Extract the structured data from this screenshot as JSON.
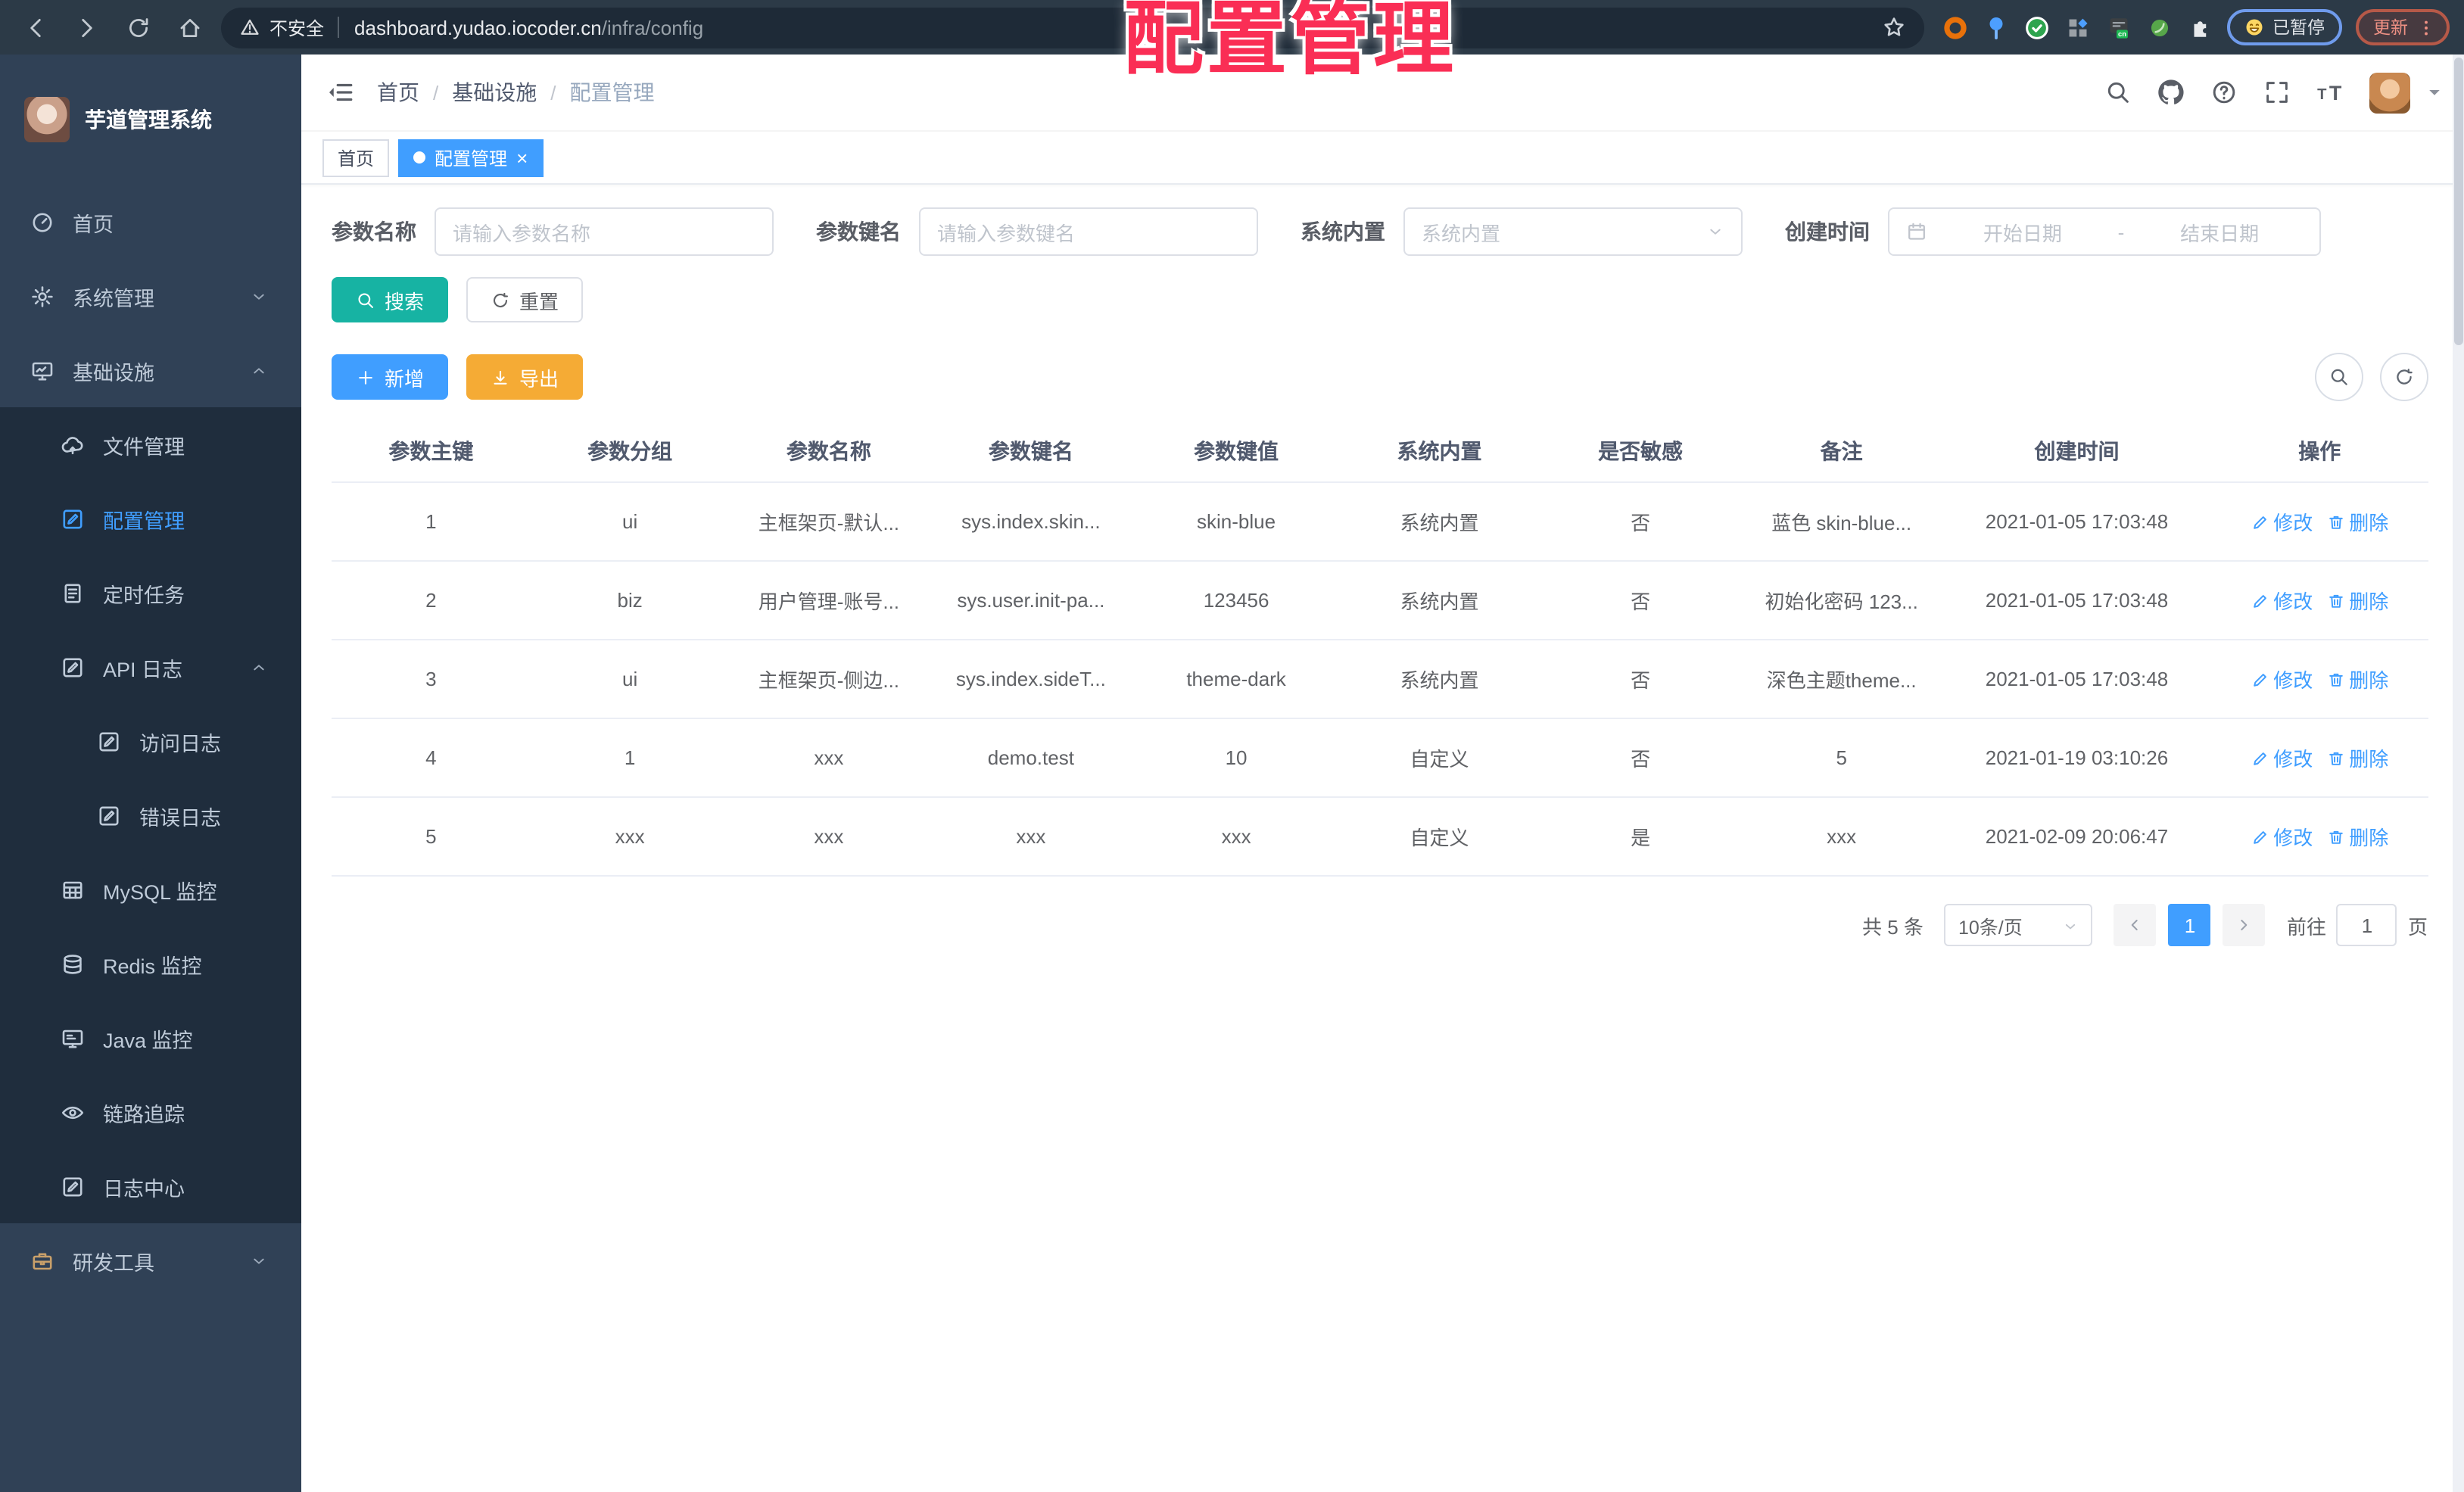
{
  "browser": {
    "security_label": "不安全",
    "url_host": "dashboard.yudao.iocoder.cn",
    "url_path": "/infra/config",
    "paused_label": "已暂停",
    "update_label": "更新"
  },
  "overlay_title": "配置管理",
  "colors": {
    "accent": "#409EFF",
    "success": "#17B3A3",
    "warning": "#F5AB35",
    "sidebar_bg": "#304156",
    "submenu_bg": "#1F2D3D",
    "annotation_red": "#FA2E55"
  },
  "sidebar": {
    "title": "芋道管理系统",
    "items": [
      {
        "icon": "dashboard",
        "label": "首页",
        "depth": 0
      },
      {
        "icon": "gear",
        "label": "系统管理",
        "depth": 0,
        "chevron": "down"
      },
      {
        "icon": "infra",
        "label": "基础设施",
        "depth": 0,
        "chevron": "up"
      },
      {
        "icon": "cloud",
        "label": "文件管理",
        "depth": 1,
        "sub": true
      },
      {
        "icon": "edit",
        "label": "配置管理",
        "depth": 1,
        "sub": true,
        "active": true
      },
      {
        "icon": "doc",
        "label": "定时任务",
        "depth": 1,
        "sub": true
      },
      {
        "icon": "edit",
        "label": "API 日志",
        "depth": 1,
        "sub": true,
        "chevron": "up"
      },
      {
        "icon": "edit",
        "label": "访问日志",
        "depth": 2,
        "sub": true
      },
      {
        "icon": "edit",
        "label": "错误日志",
        "depth": 2,
        "sub": true
      },
      {
        "icon": "mysql",
        "label": "MySQL 监控",
        "depth": 1,
        "sub": true
      },
      {
        "icon": "redis",
        "label": "Redis 监控",
        "depth": 1,
        "sub": true
      },
      {
        "icon": "java",
        "label": "Java 监控",
        "depth": 1,
        "sub": true
      },
      {
        "icon": "eye",
        "label": "链路追踪",
        "depth": 1,
        "sub": true
      },
      {
        "icon": "edit",
        "label": "日志中心",
        "depth": 1,
        "sub": true
      },
      {
        "icon": "toolbox",
        "label": "研发工具",
        "depth": 0,
        "chevron": "down"
      }
    ]
  },
  "header": {
    "breadcrumb": [
      "首页",
      "基础设施",
      "配置管理"
    ]
  },
  "tags": {
    "home": "首页",
    "current": "配置管理"
  },
  "filters": {
    "name_label": "参数名称",
    "name_placeholder": "请输入参数名称",
    "key_label": "参数键名",
    "key_placeholder": "请输入参数键名",
    "type_label": "系统内置",
    "type_placeholder": "系统内置",
    "date_label": "创建时间",
    "date_start_placeholder": "开始日期",
    "date_separator": "-",
    "date_end_placeholder": "结束日期"
  },
  "actions": {
    "search": "搜索",
    "reset": "重置",
    "add": "新增",
    "export": "导出"
  },
  "table": {
    "columns": [
      "参数主键",
      "参数分组",
      "参数名称",
      "参数键名",
      "参数键值",
      "系统内置",
      "是否敏感",
      "备注",
      "创建时间",
      "操作"
    ],
    "rows": [
      [
        "1",
        "ui",
        "主框架页-默认...",
        "sys.index.skin...",
        "skin-blue",
        "系统内置",
        "否",
        "蓝色 skin-blue...",
        "2021-01-05 17:03:48"
      ],
      [
        "2",
        "biz",
        "用户管理-账号...",
        "sys.user.init-pa...",
        "123456",
        "系统内置",
        "否",
        "初始化密码 123...",
        "2021-01-05 17:03:48"
      ],
      [
        "3",
        "ui",
        "主框架页-侧边...",
        "sys.index.sideT...",
        "theme-dark",
        "系统内置",
        "否",
        "深色主题theme...",
        "2021-01-05 17:03:48"
      ],
      [
        "4",
        "1",
        "xxx",
        "demo.test",
        "10",
        "自定义",
        "否",
        "5",
        "2021-01-19 03:10:26"
      ],
      [
        "5",
        "xxx",
        "xxx",
        "xxx",
        "xxx",
        "自定义",
        "是",
        "xxx",
        "2021-02-09 20:06:47"
      ]
    ],
    "row_actions": {
      "edit": "修改",
      "delete": "删除"
    }
  },
  "pagination": {
    "total": "共 5 条",
    "page_size": "10条/页",
    "current_page": "1",
    "goto_label": "前往",
    "goto_value": "1",
    "page_unit": "页"
  }
}
